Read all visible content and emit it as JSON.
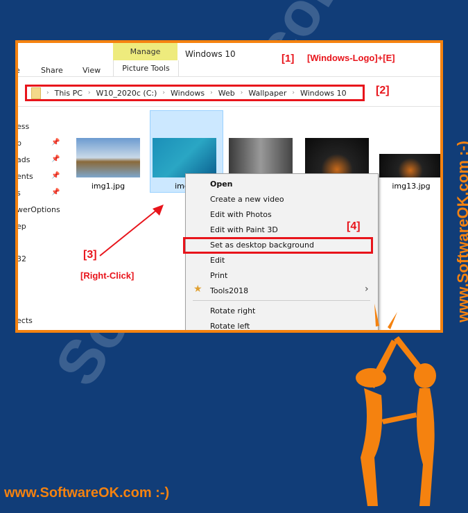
{
  "ribbon": {
    "tab_partial": "e",
    "share": "Share",
    "view": "View",
    "manage": "Manage",
    "picture_tools": "Picture Tools",
    "window_title": "Windows 10"
  },
  "annotations": {
    "a1": "[1]",
    "a1_text": "[Windows-Logo]+[E]",
    "a2": "[2]",
    "a3": "[3]",
    "a3_text": "[Right-Click]",
    "a4": "[4]"
  },
  "breadcrumb": [
    "This PC",
    "W10_2020c (C:)",
    "Windows",
    "Web",
    "Wallpaper",
    "Windows 10"
  ],
  "sidebar": [
    "ess",
    "p",
    "ads",
    "ents",
    "s",
    "werOptions",
    "ep",
    "32",
    "ects"
  ],
  "files": [
    {
      "name": "img1.jpg"
    },
    {
      "name": "img2"
    },
    {
      "name": ""
    },
    {
      "name": ""
    },
    {
      "name": "img13.jpg"
    }
  ],
  "context_menu": [
    "Open",
    "Create a new video",
    "Edit with Photos",
    "Edit with Paint 3D",
    "Set as desktop background",
    "Edit",
    "Print",
    "Tools2018",
    "Rotate right",
    "Rotate left"
  ],
  "watermark": "www.SoftwareOK.com :-)",
  "big_watermark": "SoftwareOK.com",
  "colors": {
    "background": "#113d78",
    "accent": "#f5820f",
    "annotation": "#e8141b"
  }
}
